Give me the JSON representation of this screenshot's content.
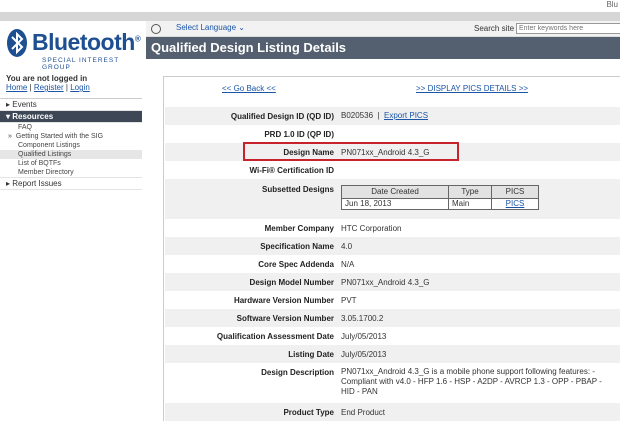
{
  "top": {
    "corner_text": "Blu"
  },
  "logo": {
    "word": "Bluetooth",
    "reg": "®",
    "sub": "SPECIAL INTEREST GROUP"
  },
  "login": {
    "status": "You are not logged in",
    "home": "Home",
    "register": "Register",
    "login": "Login",
    "sep": " | "
  },
  "nav": {
    "events": "▸ Events",
    "resources": "▾ Resources",
    "items": [
      "FAQ",
      "Getting Started with the SIG",
      "Component Listings",
      "Qualified Listings",
      "List of BQTFs",
      "Member Directory"
    ],
    "getting_started_prefix": "»",
    "report": "▸ Report Issues"
  },
  "langbar": {
    "select_language": "Select Language ⌄",
    "search_label": "Search site",
    "search_placeholder": "Enter keywords here"
  },
  "title": "Qualified Design Listing Details",
  "links": {
    "back": "<< Go Back <<",
    "pics": ">> DISPLAY PICS DETAILS >>"
  },
  "fields": {
    "qdid": {
      "label": "Qualified Design ID (QD ID)",
      "value": "B020536",
      "sep": "|",
      "export": "Export PICS"
    },
    "prd": {
      "label": "PRD 1.0 ID (QP ID)",
      "value": ""
    },
    "design_name": {
      "label": "Design Name",
      "value": "PN071xx_Android 4.3_G"
    },
    "wifi": {
      "label": "Wi-Fi® Certification ID",
      "value": ""
    },
    "subsetted": {
      "label": "Subsetted Designs"
    },
    "member_company": {
      "label": "Member Company",
      "value": "HTC Corporation"
    },
    "spec_name": {
      "label": "Specification Name",
      "value": "4.0"
    },
    "core_spec": {
      "label": "Core Spec Addenda",
      "value": "N/A"
    },
    "model_number": {
      "label": "Design Model Number",
      "value": "PN071xx_Android 4.3_G"
    },
    "hw_version": {
      "label": "Hardware Version Number",
      "value": "PVT"
    },
    "sw_version": {
      "label": "Software Version Number",
      "value": "3.05.1700.2"
    },
    "qa_date": {
      "label": "Qualification Assessment Date",
      "value": "July/05/2013"
    },
    "listing_date": {
      "label": "Listing Date",
      "value": "July/05/2013"
    },
    "description": {
      "label": "Design Description",
      "value": "PN071xx_Android 4.3_G is a mobile phone support following features: - Compliant with v4.0 - HFP 1.6 - HSP - A2DP - AVRCP 1.3 - OPP - PBAP - HID - PAN"
    },
    "product_type": {
      "label": "Product Type",
      "value": "End Product"
    }
  },
  "subsetted_table": {
    "headers": [
      "Date Created",
      "Type",
      "PICS"
    ],
    "rows": [
      {
        "date": "Jun 18, 2013",
        "type": "Main",
        "pics": "PICS"
      }
    ]
  }
}
